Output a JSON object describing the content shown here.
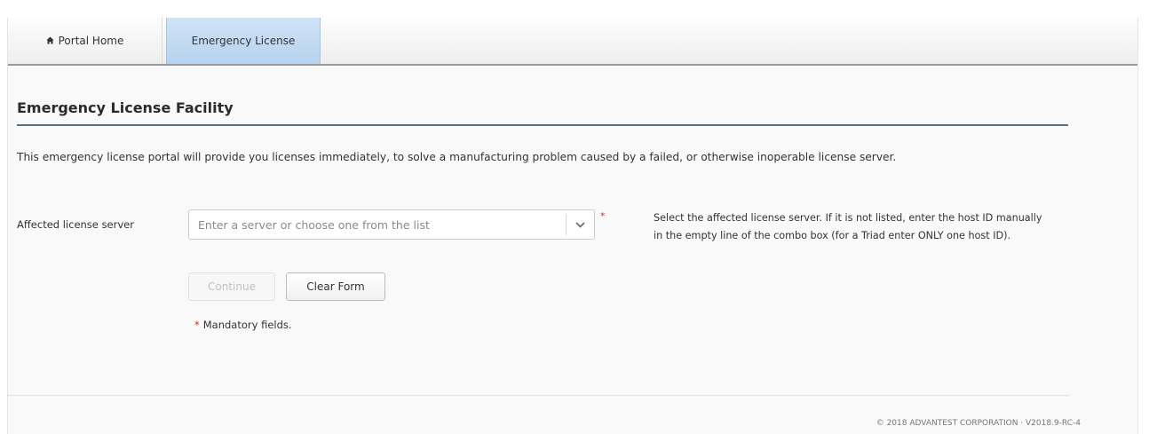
{
  "nav": {
    "home_label": "Portal Home",
    "home_icon": "home-icon",
    "active_tab_label": "Emergency License"
  },
  "page": {
    "title": "Emergency License Facility",
    "intro": "This emergency license portal will provide you licenses immediately, to solve a manufacturing problem caused by a failed, or otherwise inoperable license server."
  },
  "form": {
    "server_label": "Affected license server",
    "server_value": "",
    "server_placeholder": "Enter a server or choose one from the list",
    "required_mark": "*",
    "help_line1": "Select the affected license server. If it is not listed, enter the host ID manually",
    "help_line2": "in the empty line of the combo box (for a Triad enter ONLY one host ID).",
    "continue_label": "Continue",
    "continue_enabled": false,
    "clear_label": "Clear Form",
    "mandatory_star": "*",
    "mandatory_note": "Mandatory fields."
  },
  "footer": {
    "text": "© 2018 ADVANTEST CORPORATION · V2018.9-rc-4"
  },
  "colors": {
    "active_tab": "#c3dbf3",
    "heading_rule": "#5a7185",
    "required": "#c9302c",
    "nav_border": "#9a9a9a"
  }
}
